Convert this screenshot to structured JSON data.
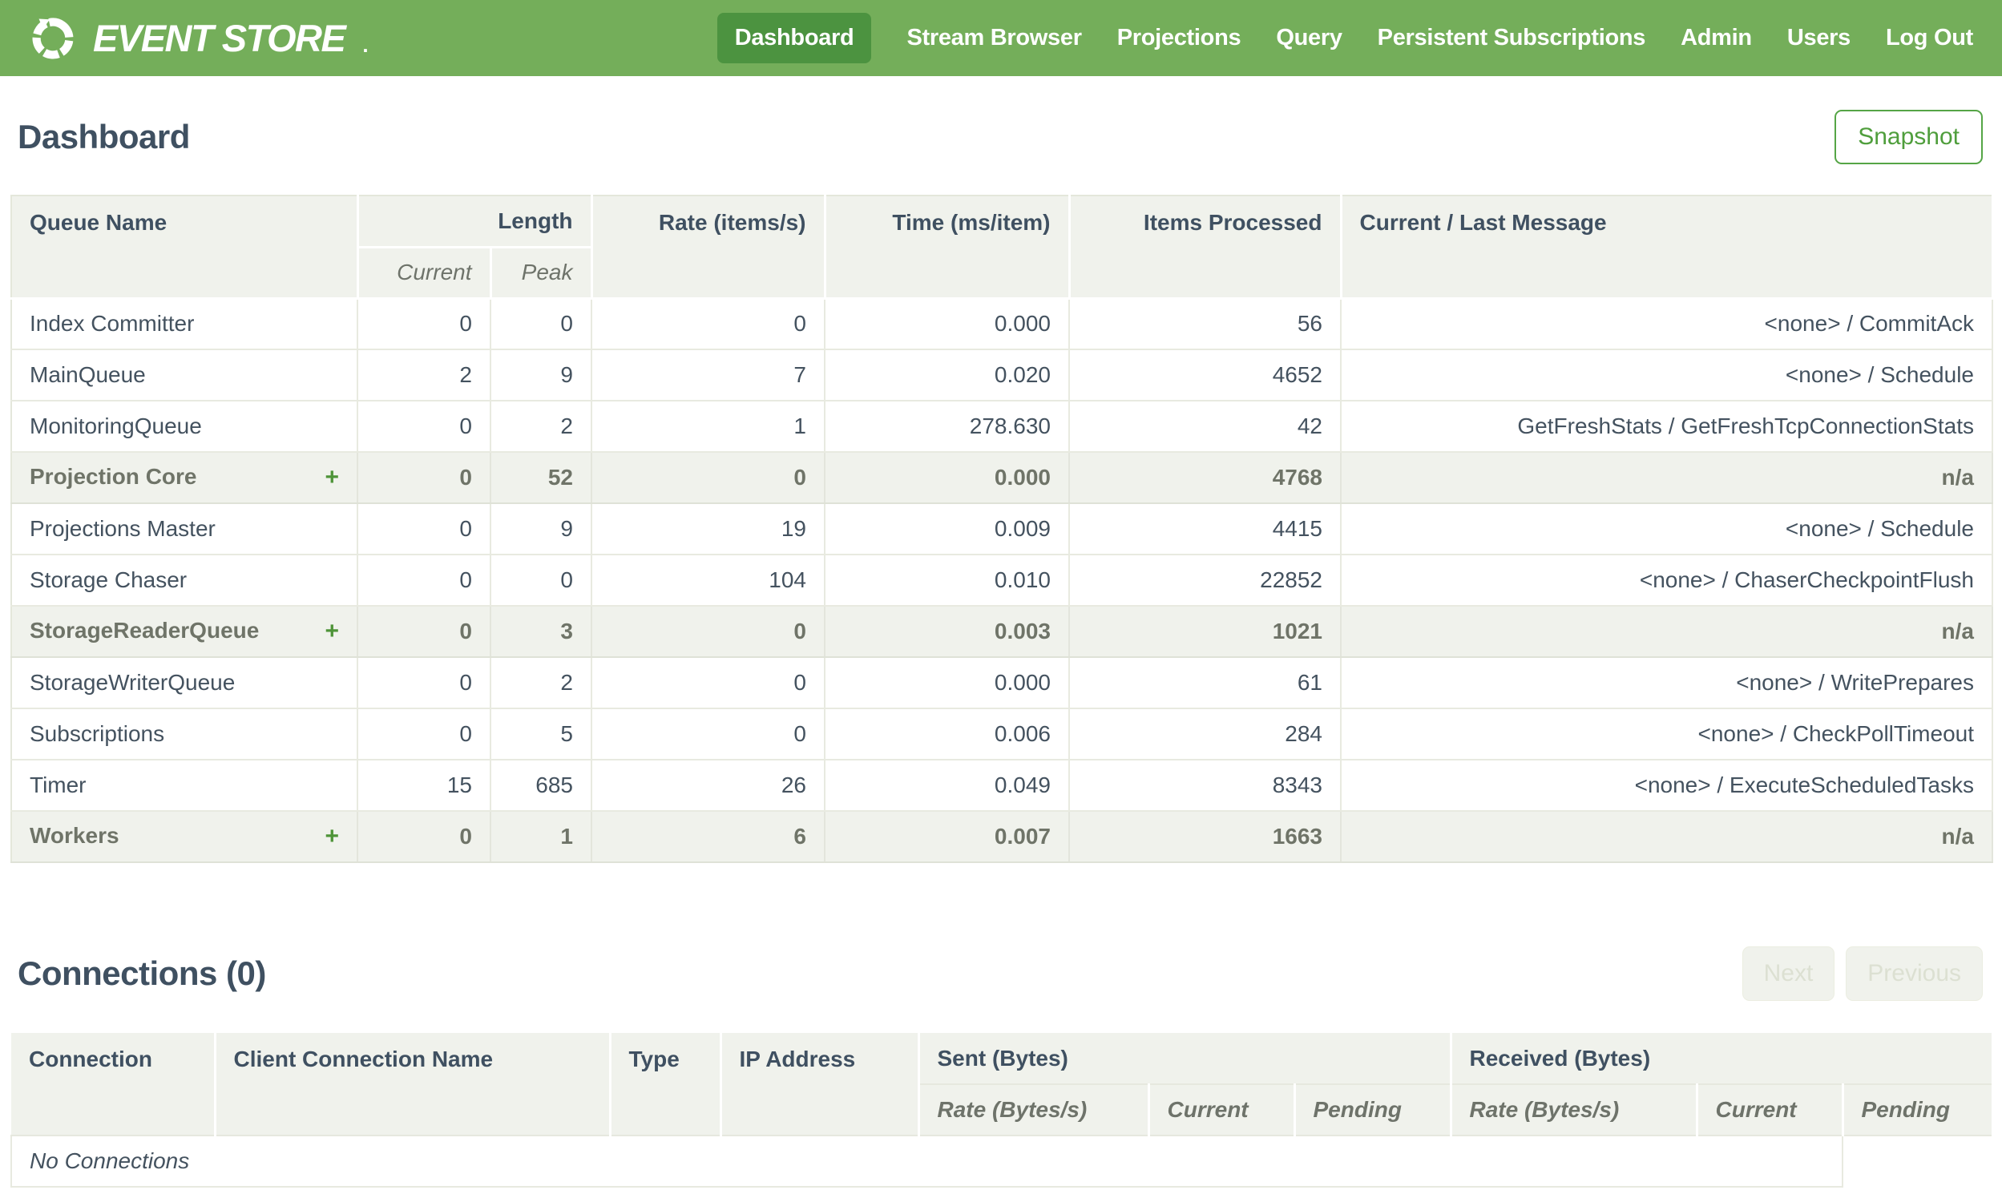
{
  "nav": {
    "brand": "EVENT STORE",
    "brand_mark": ".",
    "items": [
      {
        "label": "Dashboard",
        "active": true
      },
      {
        "label": "Stream Browser",
        "active": false
      },
      {
        "label": "Projections",
        "active": false
      },
      {
        "label": "Query",
        "active": false
      },
      {
        "label": "Persistent Subscriptions",
        "active": false
      },
      {
        "label": "Admin",
        "active": false
      },
      {
        "label": "Users",
        "active": false
      },
      {
        "label": "Log Out",
        "active": false
      }
    ]
  },
  "page": {
    "title": "Dashboard",
    "snapshot_label": "Snapshot"
  },
  "queues": {
    "expand_symbol": "+",
    "headers": {
      "queue_name": "Queue Name",
      "length": "Length",
      "current": "Current",
      "peak": "Peak",
      "rate": "Rate (items/s)",
      "time": "Time (ms/item)",
      "items_processed": "Items Processed",
      "message": "Current / Last Message"
    },
    "rows": [
      {
        "name": "Index Committer",
        "current": "0",
        "peak": "0",
        "rate": "0",
        "time": "0.000",
        "items": "56",
        "message": "<none> / CommitAck",
        "group": false
      },
      {
        "name": "MainQueue",
        "current": "2",
        "peak": "9",
        "rate": "7",
        "time": "0.020",
        "items": "4652",
        "message": "<none> / Schedule",
        "group": false
      },
      {
        "name": "MonitoringQueue",
        "current": "0",
        "peak": "2",
        "rate": "1",
        "time": "278.630",
        "items": "42",
        "message": "GetFreshStats / GetFreshTcpConnectionStats",
        "group": false
      },
      {
        "name": "Projection Core",
        "current": "0",
        "peak": "52",
        "rate": "0",
        "time": "0.000",
        "items": "4768",
        "message": "n/a",
        "group": true
      },
      {
        "name": "Projections Master",
        "current": "0",
        "peak": "9",
        "rate": "19",
        "time": "0.009",
        "items": "4415",
        "message": "<none> / Schedule",
        "group": false
      },
      {
        "name": "Storage Chaser",
        "current": "0",
        "peak": "0",
        "rate": "104",
        "time": "0.010",
        "items": "22852",
        "message": "<none> / ChaserCheckpointFlush",
        "group": false
      },
      {
        "name": "StorageReaderQueue",
        "current": "0",
        "peak": "3",
        "rate": "0",
        "time": "0.003",
        "items": "1021",
        "message": "n/a",
        "group": true
      },
      {
        "name": "StorageWriterQueue",
        "current": "0",
        "peak": "2",
        "rate": "0",
        "time": "0.000",
        "items": "61",
        "message": "<none> / WritePrepares",
        "group": false
      },
      {
        "name": "Subscriptions",
        "current": "0",
        "peak": "5",
        "rate": "0",
        "time": "0.006",
        "items": "284",
        "message": "<none> / CheckPollTimeout",
        "group": false
      },
      {
        "name": "Timer",
        "current": "15",
        "peak": "685",
        "rate": "26",
        "time": "0.049",
        "items": "8343",
        "message": "<none> / ExecuteScheduledTasks",
        "group": false
      },
      {
        "name": "Workers",
        "current": "0",
        "peak": "1",
        "rate": "6",
        "time": "0.007",
        "items": "1663",
        "message": "n/a",
        "group": true
      }
    ]
  },
  "connections": {
    "title": "Connections (0)",
    "next_label": "Next",
    "previous_label": "Previous",
    "headers": {
      "connection": "Connection",
      "client_name": "Client Connection Name",
      "type": "Type",
      "ip": "IP Address",
      "sent": "Sent (Bytes)",
      "received": "Received (Bytes)",
      "rate": "Rate (Bytes/s)",
      "current": "Current",
      "pending": "Pending"
    },
    "empty_message": "No Connections"
  },
  "colors": {
    "nav_green": "#74ae5a",
    "active_tab_green": "#4c9340",
    "accent_green": "#55a546",
    "plus_green": "#4e9438",
    "heading_slate": "#3f5061",
    "body_text": "#44525f",
    "group_text": "#6f7468",
    "header_bg": "#f0f2ec",
    "border": "#e8eae0",
    "disabled_text": "#dce0d2"
  }
}
